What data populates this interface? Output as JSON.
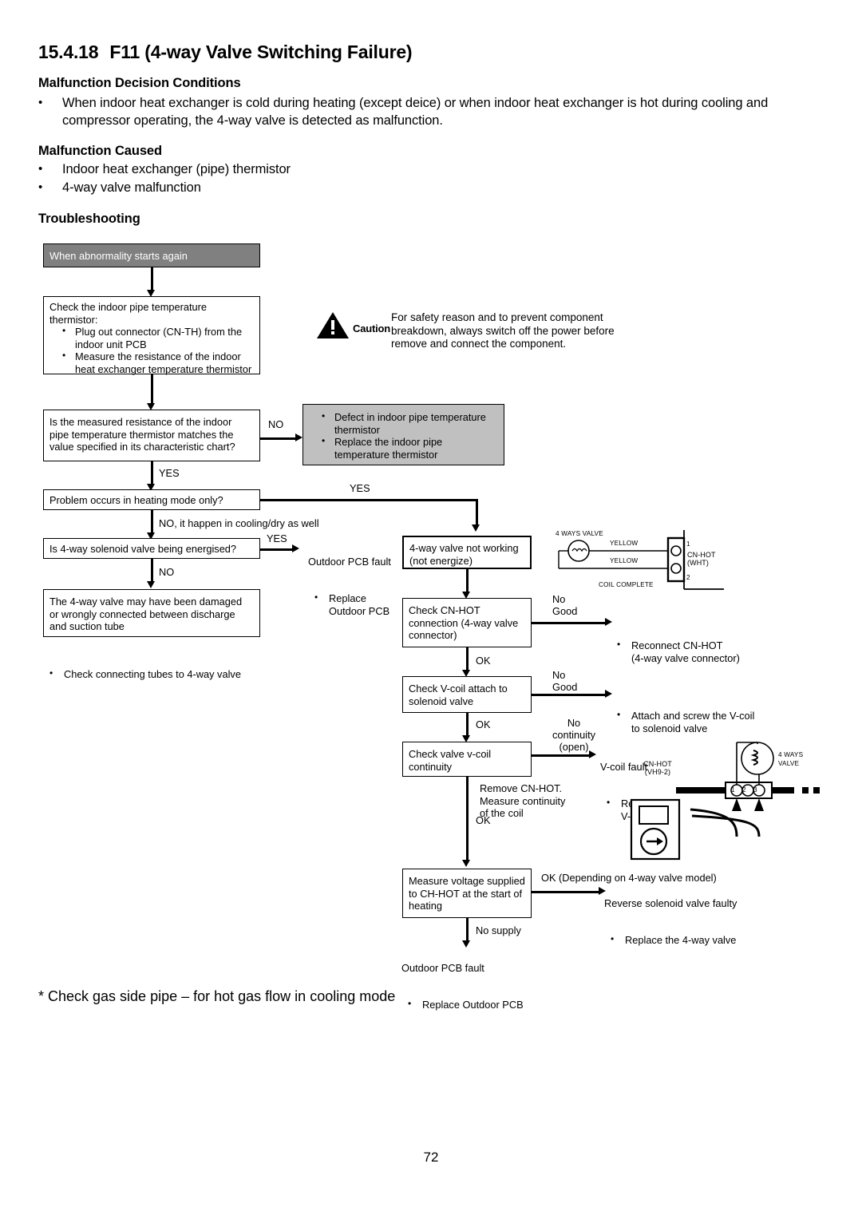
{
  "document": {
    "section_number": "15.4.18",
    "section_title": "F11 (4-way Valve Switching Failure)",
    "page_number": "72",
    "footnote": "* Check gas side pipe – for hot gas flow in cooling mode"
  },
  "sections": {
    "decision_conditions": {
      "heading": "Malfunction Decision Conditions",
      "bullets": [
        "When indoor heat exchanger is cold during heating (except deice) or when indoor heat exchanger is hot during cooling and compressor operating, the 4-way valve is detected as malfunction."
      ]
    },
    "malfunction_caused": {
      "heading": "Malfunction Caused",
      "bullets": [
        "Indoor heat exchanger (pipe) thermistor",
        "4-way valve malfunction"
      ]
    },
    "troubleshooting": {
      "heading": "Troubleshooting"
    }
  },
  "caution": {
    "label": "Caution",
    "text": "For safety reason and to prevent component\nbreakdown, always switch off the power before\nremove and connect the component."
  },
  "flow": {
    "start_box": "When abnormality starts again",
    "check_thermistor": {
      "intro": "Check the indoor pipe temperature\nthermistor:",
      "bullets": [
        "Plug out connector (CN-TH) from the indoor unit PCB",
        "Measure the resistance of the indoor heat exchanger temperature thermistor"
      ]
    },
    "resistance_question": "Is the measured resistance of the indoor pipe temperature thermistor matches the value specified in its characteristic chart?",
    "defect_box": [
      "Defect in indoor pipe temperature thermistor",
      "Replace the indoor pipe temperature thermistor"
    ],
    "heating_mode_question": "Problem occurs in heating mode only?",
    "solenoid_question": "Is 4-way solenoid valve being energised?",
    "damaged_box": "The 4-way valve may have been damaged or wrongly connected between discharge and suction tube",
    "check_tubes_note": "Check connecting tubes to 4-way valve",
    "outdoor_pcb_fault_1": {
      "title": "Outdoor PCB fault",
      "bullet": "Replace\nOutdoor PCB"
    },
    "valve_not_working": "4-way valve not working\n(not energize)",
    "check_cnhot": "Check CN-HOT\nconnection\n(4-way valve connector)",
    "reconnect_cnhot": "Reconnect CN-HOT\n(4-way valve connector)",
    "check_vcoil_attach": "Check V-coil attach to\nsolenoid valve",
    "attach_screw_vcoil": "Attach and screw the V-coil\nto solenoid valve",
    "check_vcoil_continuity": "Check valve v-coil\ncontinuity",
    "vcoil_fault_title": "V-coil fault",
    "vcoil_fault_bullet": "Replace\nV-coil only",
    "remove_cnhot_note": "Remove CN-HOT.\nMeasure continuity\nof the coil",
    "measure_voltage": "Measure voltage\nsupplied to CH-HOT at\nthe start of heating",
    "reverse_solenoid_title": "Reverse solenoid valve faulty",
    "reverse_solenoid_bullet": "Replace the 4-way valve",
    "outdoor_pcb_fault_2": {
      "title": "Outdoor PCB fault",
      "bullet": "Replace Outdoor PCB"
    }
  },
  "flow_labels": {
    "no_1": "NO",
    "yes_1": "YES",
    "yes_2": "YES",
    "no_cooling_dry": "NO, it happen in cooling/dry as well",
    "yes_3": "YES",
    "no_2": "NO",
    "no_good_1": "No\nGood",
    "ok_1": "OK",
    "no_good_2": "No\nGood",
    "ok_2": "OK",
    "no_continuity": "No\ncontinuity\n(open)",
    "ok_3": "OK",
    "ok_depending": "OK (Depending on 4-way valve model)",
    "no_supply": "No supply"
  },
  "wiring_diagram_top": {
    "valve_label": "4 WAYS VALVE",
    "wire_1": "YELLOW",
    "wire_2": "YELLOW",
    "connector": "CN-HOT\n(WHT)",
    "pin_1": "1",
    "pin_2": "2",
    "coil_note": "COIL COMPLETE"
  },
  "wiring_diagram_bottom": {
    "connector": "CN-HOT\n(VH9-2)",
    "valve_label": "4 WAYS\nVALVE",
    "pins": [
      "1",
      "2",
      "3"
    ]
  }
}
